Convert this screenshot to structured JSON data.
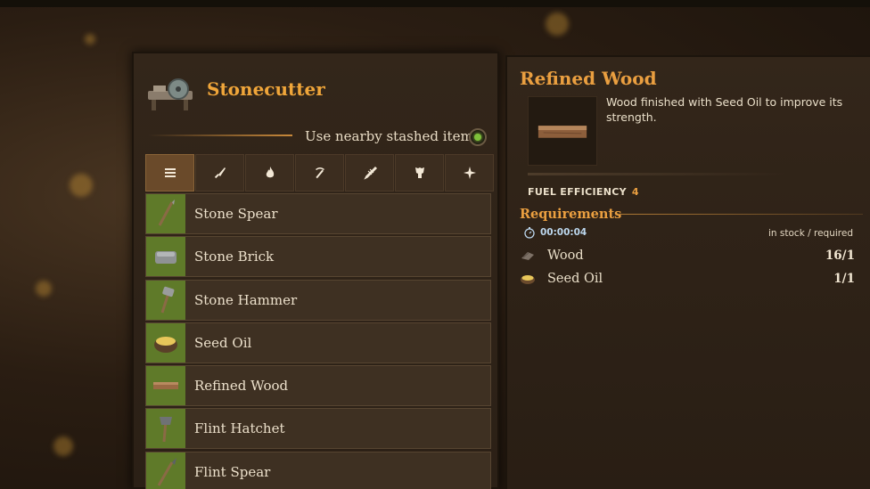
{
  "station": {
    "title": "Stonecutter",
    "icon": "stonecutter-icon"
  },
  "stash": {
    "label": "Use nearby stashed items",
    "enabled": true
  },
  "tabs": [
    {
      "icon": "list-icon",
      "active": true
    },
    {
      "icon": "blade-icon",
      "active": false
    },
    {
      "icon": "flame-icon",
      "active": false
    },
    {
      "icon": "pickaxe-icon",
      "active": false
    },
    {
      "icon": "feather-icon",
      "active": false
    },
    {
      "icon": "armor-icon",
      "active": false
    },
    {
      "icon": "sparkle-icon",
      "active": false
    }
  ],
  "recipes": [
    {
      "label": "Stone Spear",
      "icon": "stone-spear-icon"
    },
    {
      "label": "Stone Brick",
      "icon": "stone-brick-icon"
    },
    {
      "label": "Stone Hammer",
      "icon": "stone-hammer-icon"
    },
    {
      "label": "Seed Oil",
      "icon": "seed-oil-icon"
    },
    {
      "label": "Refined Wood",
      "icon": "refined-wood-icon"
    },
    {
      "label": "Flint Hatchet",
      "icon": "flint-hatchet-icon"
    },
    {
      "label": "Flint Spear",
      "icon": "flint-spear-icon"
    }
  ],
  "detail": {
    "title": "Refined Wood",
    "description": "Wood finished with Seed Oil to improve its strength.",
    "fuel_label": "FUEL EFFICIENCY",
    "fuel_value": "4",
    "requirements_label": "Requirements",
    "craft_time": "00:00:04",
    "stock_header": "in stock / required",
    "requirements": [
      {
        "name": "Wood",
        "count": "16/1",
        "icon": "wood-icon"
      },
      {
        "name": "Seed Oil",
        "count": "1/1",
        "icon": "seed-oil-icon"
      }
    ]
  },
  "colors": {
    "accent": "#ea9f40",
    "thumb_bg": "#5f7a29",
    "toggle_on": "#7ec03a"
  }
}
